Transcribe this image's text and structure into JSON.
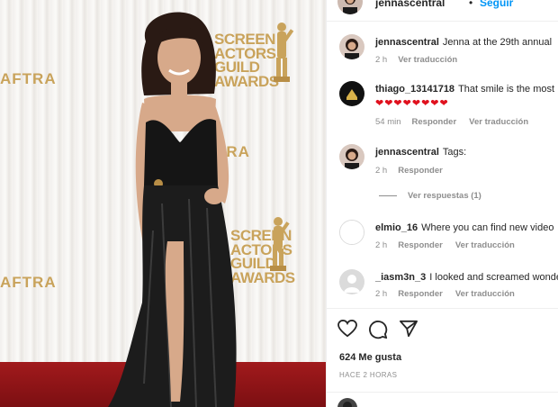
{
  "post": {
    "author": "jennascentral",
    "separator": "•",
    "follow_label": "Seguir"
  },
  "backdrop": {
    "logo_lines": [
      "SCREEN",
      "ACTORS",
      "GUILD",
      "AWARDS"
    ],
    "aftra_text": "AFTRA",
    "aftra_short": "TRA",
    "gold": "#c9a35b"
  },
  "comments": [
    {
      "user": "jennascentral",
      "text": "Jenna at the 29th annual",
      "time": "2 h",
      "actions": [
        "Ver traducción"
      ]
    },
    {
      "user": "thiago_13141718",
      "text": "That smile is the most I",
      "hearts": "❤❤❤❤❤❤❤❤",
      "time": "54 min",
      "actions": [
        "Responder",
        "Ver traducción"
      ]
    },
    {
      "user": "jennascentral",
      "text": "Tags:",
      "time": "2 h",
      "actions": [
        "Responder"
      ]
    },
    {
      "user": "elmio_16",
      "text": "Where you can find new video",
      "time": "2 h",
      "actions": [
        "Responder",
        "Ver traducción"
      ]
    },
    {
      "user": "_iasm3n_3",
      "text": "I looked and screamed wonde",
      "time": "2 h",
      "actions": [
        "Responder",
        "Ver traducción"
      ]
    }
  ],
  "view_replies": "Ver respuestas (1)",
  "likes": "624 Me gusta",
  "timeago": "HACE 2 HORAS",
  "icons": {
    "like": "heart-icon",
    "comment": "comment-icon",
    "share": "share-icon"
  },
  "colors": {
    "accent": "#0095f6",
    "heart": "#e0101d",
    "carpet": "#a11a1c"
  }
}
